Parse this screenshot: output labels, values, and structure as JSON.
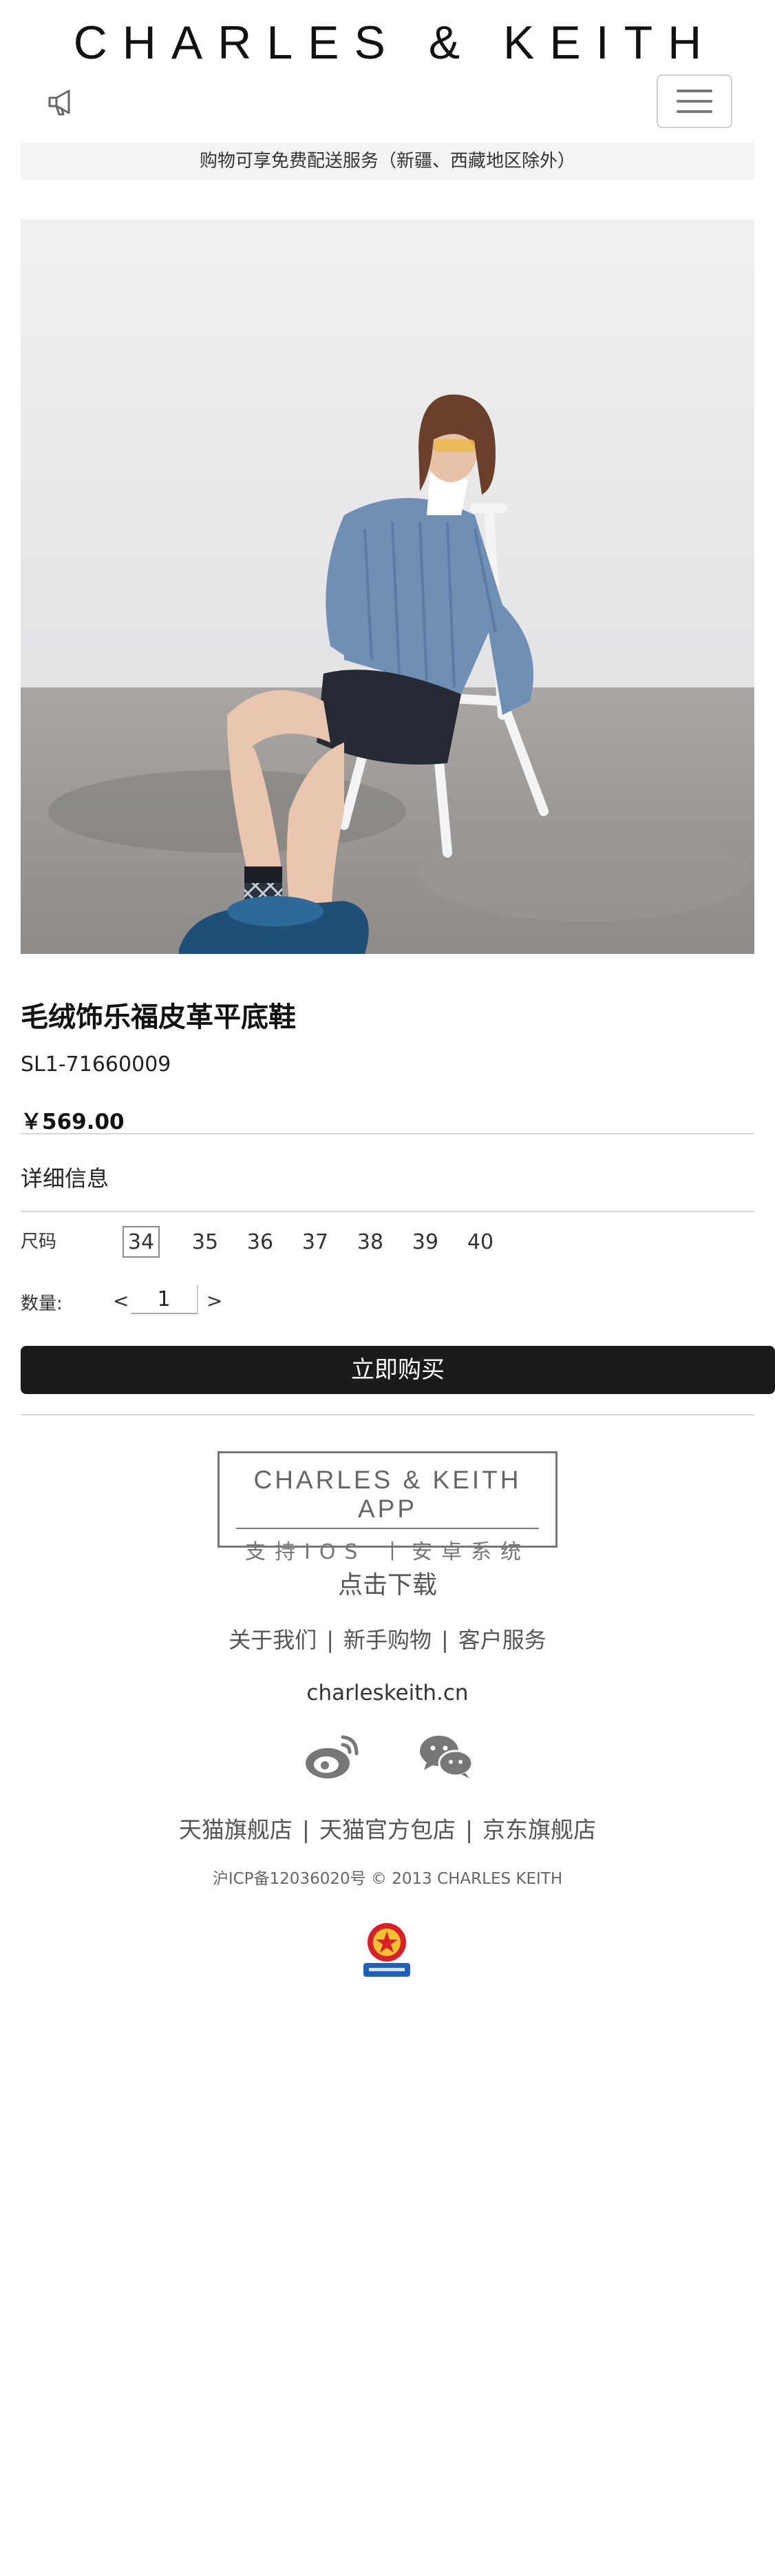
{
  "header": {
    "brand": "CHARLES & KEITH",
    "promo": "购物可享免费配送服务（新疆、西藏地区除外）"
  },
  "product": {
    "name": "毛绒饰乐福皮革平底鞋",
    "sku": "SL1-71660009",
    "price": "￥569.00",
    "details_label": "详细信息",
    "size_label": "尺码",
    "sizes": [
      "34",
      "35",
      "36",
      "37",
      "38",
      "39",
      "40"
    ],
    "selected_size": "34",
    "qty_label": "数量:",
    "qty_dec": "<",
    "qty_inc": ">",
    "qty_value": "1",
    "buy_label": "立即购买"
  },
  "footer": {
    "app_title": "CHARLES & KEITH APP",
    "app_sub": "支持IOS 丨安卓系统",
    "download": "点击下载",
    "links": [
      "关于我们",
      "新手购物",
      "客户服务"
    ],
    "link_sep": "|",
    "site": "charleskeith.cn",
    "stores": [
      "天猫旗舰店",
      "天猫官方包店",
      "京东旗舰店"
    ],
    "copyright": "沪ICP备12036020号 © 2013 CHARLES KEITH"
  },
  "icons": {
    "announce": "megaphone-icon",
    "menu": "hamburger-menu-icon",
    "weibo": "weibo-icon",
    "wechat": "wechat-icon",
    "gov": "gov-license-badge-icon"
  },
  "colors": {
    "button_bg": "#1b1b1b",
    "promo_bg": "#f4f4f4",
    "footer_text": "#555555"
  }
}
